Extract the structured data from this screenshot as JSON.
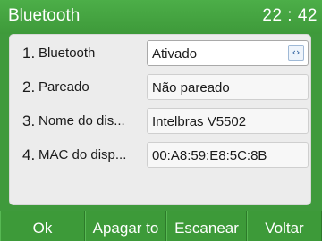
{
  "header": {
    "title": "Bluetooth",
    "time": "22 : 42"
  },
  "rows": [
    {
      "number": "1.",
      "label": "Bluetooth",
      "value": "Ativado",
      "control": "select"
    },
    {
      "number": "2.",
      "label": "Pareado",
      "value": "Não pareado"
    },
    {
      "number": "3.",
      "label": "Nome do dis...",
      "value": "Intelbras V5502"
    },
    {
      "number": "4.",
      "label": "MAC do disp...",
      "value": "00:A8:59:E8:5C:8B"
    }
  ],
  "softkeys": {
    "ok": "Ok",
    "delete": "Apagar to",
    "scan": "Escanear",
    "back": "Voltar"
  },
  "icons": {
    "select_arrow": "left-right-arrows-icon"
  },
  "colors": {
    "header_green": "#3f9a3c",
    "panel_bg": "#ececec",
    "select_icon_blue": "#2a5d9c"
  }
}
